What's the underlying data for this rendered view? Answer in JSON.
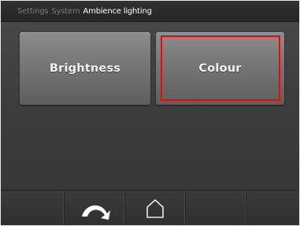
{
  "breadcrumb": {
    "items": [
      "Settings",
      "System",
      "Ambience lighting"
    ]
  },
  "tiles": [
    {
      "label": "Brightness"
    },
    {
      "label": "Colour",
      "selected": true
    }
  ],
  "bottom_bar": {
    "back_icon": "back-arrow-icon",
    "home_icon": "home-icon"
  },
  "colors": {
    "selection": "#ff0000",
    "title_current": "#ffffff",
    "title_inactive": "#7a7a7a"
  }
}
